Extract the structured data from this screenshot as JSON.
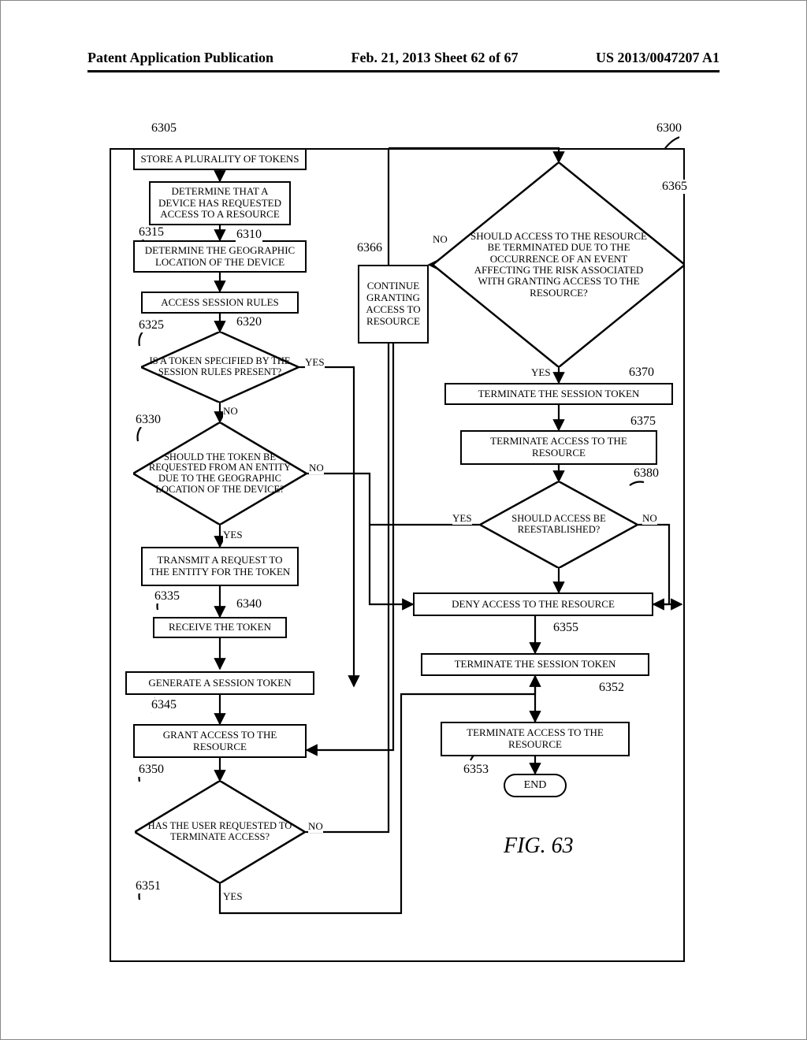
{
  "header": {
    "left": "Patent Application Publication",
    "center": "Feb. 21, 2013  Sheet 62 of 67",
    "right": "US 2013/0047207 A1"
  },
  "figure_label": "FIG. 63",
  "refs": {
    "r6300": "6300",
    "r6305": "6305",
    "r6310": "6310",
    "r6315": "6315",
    "r6320": "6320",
    "r6325": "6325",
    "r6330": "6330",
    "r6335": "6335",
    "r6340": "6340",
    "r6345": "6345",
    "r6350": "6350",
    "r6351": "6351",
    "r6352": "6352",
    "r6353": "6353",
    "r6355": "6355",
    "r6365": "6365",
    "r6366": "6366",
    "r6370": "6370",
    "r6375": "6375",
    "r6380": "6380"
  },
  "edges": {
    "yes": "YES",
    "no": "NO"
  },
  "steps": {
    "s6305": "STORE A PLURALITY OF TOKENS",
    "s6310": "DETERMINE THAT A DEVICE HAS REQUESTED ACCESS TO A RESOURCE",
    "s6315": "DETERMINE THE GEOGRAPHIC LOCATION OF THE DEVICE",
    "s6320": "ACCESS SESSION RULES",
    "s6325": "IS A TOKEN SPECIFIED BY THE SESSION RULES PRESENT?",
    "s6330": "SHOULD THE TOKEN BE REQUESTED FROM AN ENTITY DUE TO THE GEOGRAPHIC LOCATION OF THE DEVICE?",
    "s6335": "TRANSMIT A REQUEST TO THE ENTITY FOR THE TOKEN",
    "s6340": "RECEIVE THE TOKEN",
    "s6345": "GENERATE A SESSION TOKEN",
    "s6350": "GRANT ACCESS TO THE RESOURCE",
    "s6351": "HAS THE USER REQUESTED TO TERMINATE ACCESS?",
    "s6352": "TERMINATE THE SESSION TOKEN",
    "s6353": "TERMINATE ACCESS TO THE RESOURCE",
    "s6355": "DENY ACCESS TO THE RESOURCE",
    "s6365": "SHOULD ACCESS TO THE RESOURCE BE TERMINATED DUE TO THE OCCURRENCE OF AN EVENT AFFECTING THE RISK ASSOCIATED WITH GRANTING ACCESS TO THE RESOURCE?",
    "s6366": "CONTINUE GRANTING ACCESS TO RESOURCE",
    "s6370": "TERMINATE THE SESSION TOKEN",
    "s6375": "TERMINATE ACCESS TO THE RESOURCE",
    "s6380": "SHOULD ACCESS BE REESTABLISHED?",
    "end": "END"
  }
}
